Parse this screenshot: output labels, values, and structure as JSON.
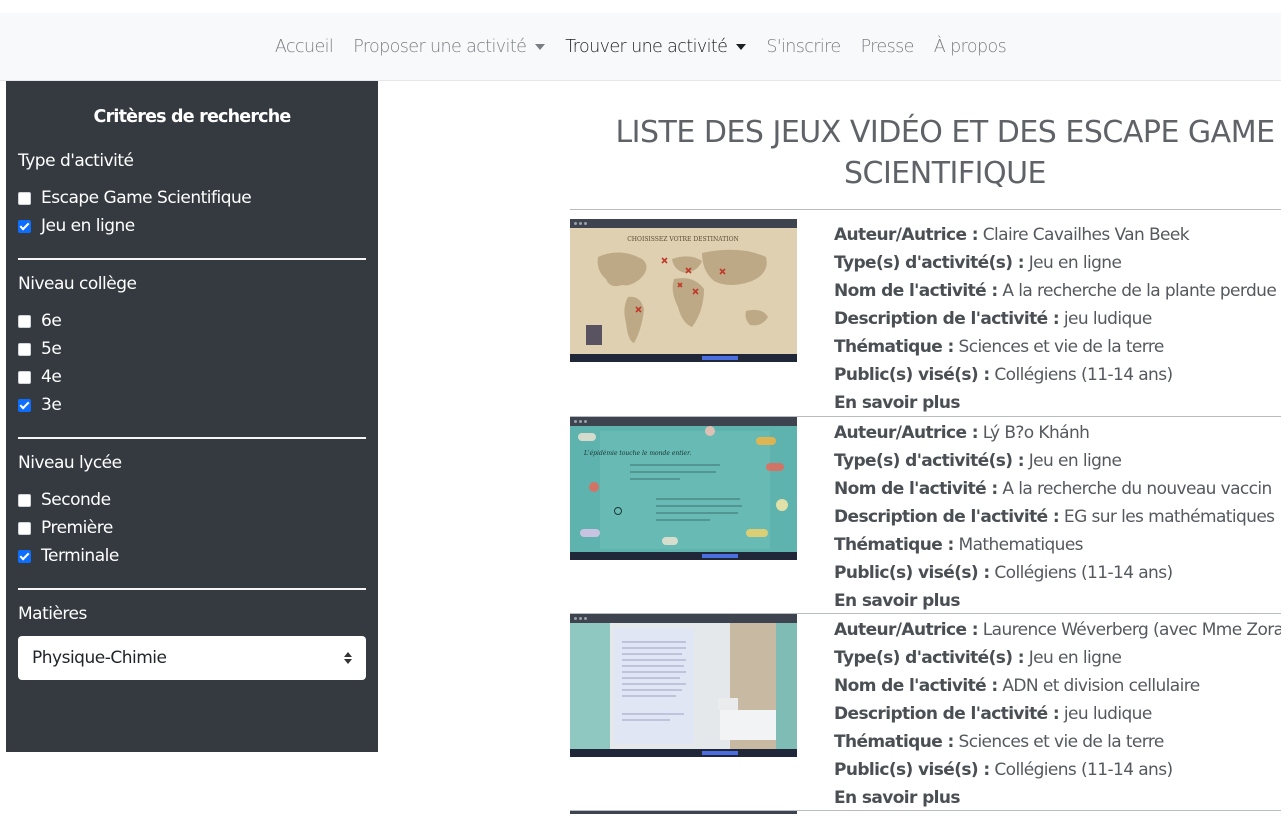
{
  "nav": {
    "items": [
      {
        "label": "Accueil",
        "dropdown": false,
        "active": false
      },
      {
        "label": "Proposer une activité",
        "dropdown": true,
        "active": false
      },
      {
        "label": "Trouver une activité",
        "dropdown": true,
        "active": true
      },
      {
        "label": "S'inscrire",
        "dropdown": false,
        "active": false
      },
      {
        "label": "Presse",
        "dropdown": false,
        "active": false
      },
      {
        "label": "À propos",
        "dropdown": false,
        "active": false
      }
    ]
  },
  "sidebar": {
    "title": "Critères de recherche",
    "activity_type": {
      "label": "Type d'activité",
      "options": [
        {
          "label": "Escape Game Scientifique",
          "checked": false
        },
        {
          "label": "Jeu en ligne",
          "checked": true
        }
      ]
    },
    "college": {
      "label": "Niveau collège",
      "options": [
        {
          "label": "6e",
          "checked": false
        },
        {
          "label": "5e",
          "checked": false
        },
        {
          "label": "4e",
          "checked": false
        },
        {
          "label": "3e",
          "checked": true
        }
      ]
    },
    "lycee": {
      "label": "Niveau lycée",
      "options": [
        {
          "label": "Seconde",
          "checked": false
        },
        {
          "label": "Première",
          "checked": false
        },
        {
          "label": "Terminale",
          "checked": true
        }
      ]
    },
    "subjects": {
      "label": "Matières",
      "selected": "Physique-Chimie"
    }
  },
  "main": {
    "title_line1": "LISTE DES JEUX VIDÉO ET DES ESCAPE GAME",
    "title_line2": "SCIENTIFIQUE",
    "field_labels": {
      "author": "Auteur/Autrice :",
      "type": "Type(s) d'activité(s) :",
      "name": "Nom de l'activité :",
      "description": "Description de l'activité :",
      "theme": "Thématique :",
      "audience": "Public(s) visé(s) :",
      "more": "En savoir plus"
    },
    "activities": [
      {
        "author": "Claire Cavailhes Van Beek",
        "type": "Jeu en ligne",
        "name": "A la recherche de la plante perdue",
        "description": "jeu ludique",
        "theme": "Sciences et vie de la terre",
        "audience": "Collégiens (11-14 ans)",
        "thumb_caption": "CHOISISSEZ VOTRE DESTINATION"
      },
      {
        "author": "Lý B?o Khánh",
        "type": "Jeu en ligne",
        "name": "A la recherche du nouveau vaccin",
        "description": "EG sur les mathématiques",
        "theme": "Mathematiques",
        "audience": "Collégiens (11-14 ans)",
        "thumb_caption": "L'épidémie touche le monde entier."
      },
      {
        "author": "Laurence Wéverberg (avec Mme Zorai)",
        "type": "Jeu en ligne",
        "name": "ADN et division cellulaire",
        "description": "jeu ludique",
        "theme": "Sciences et vie de la terre",
        "audience": "Collégiens (11-14 ans)",
        "thumb_caption": ""
      }
    ]
  },
  "colors": {
    "navbar_bg": "#f8f9fa",
    "sidebar_bg": "#343a40",
    "checkbox_checked": "#0d6efd",
    "title_color": "#5f6368"
  }
}
